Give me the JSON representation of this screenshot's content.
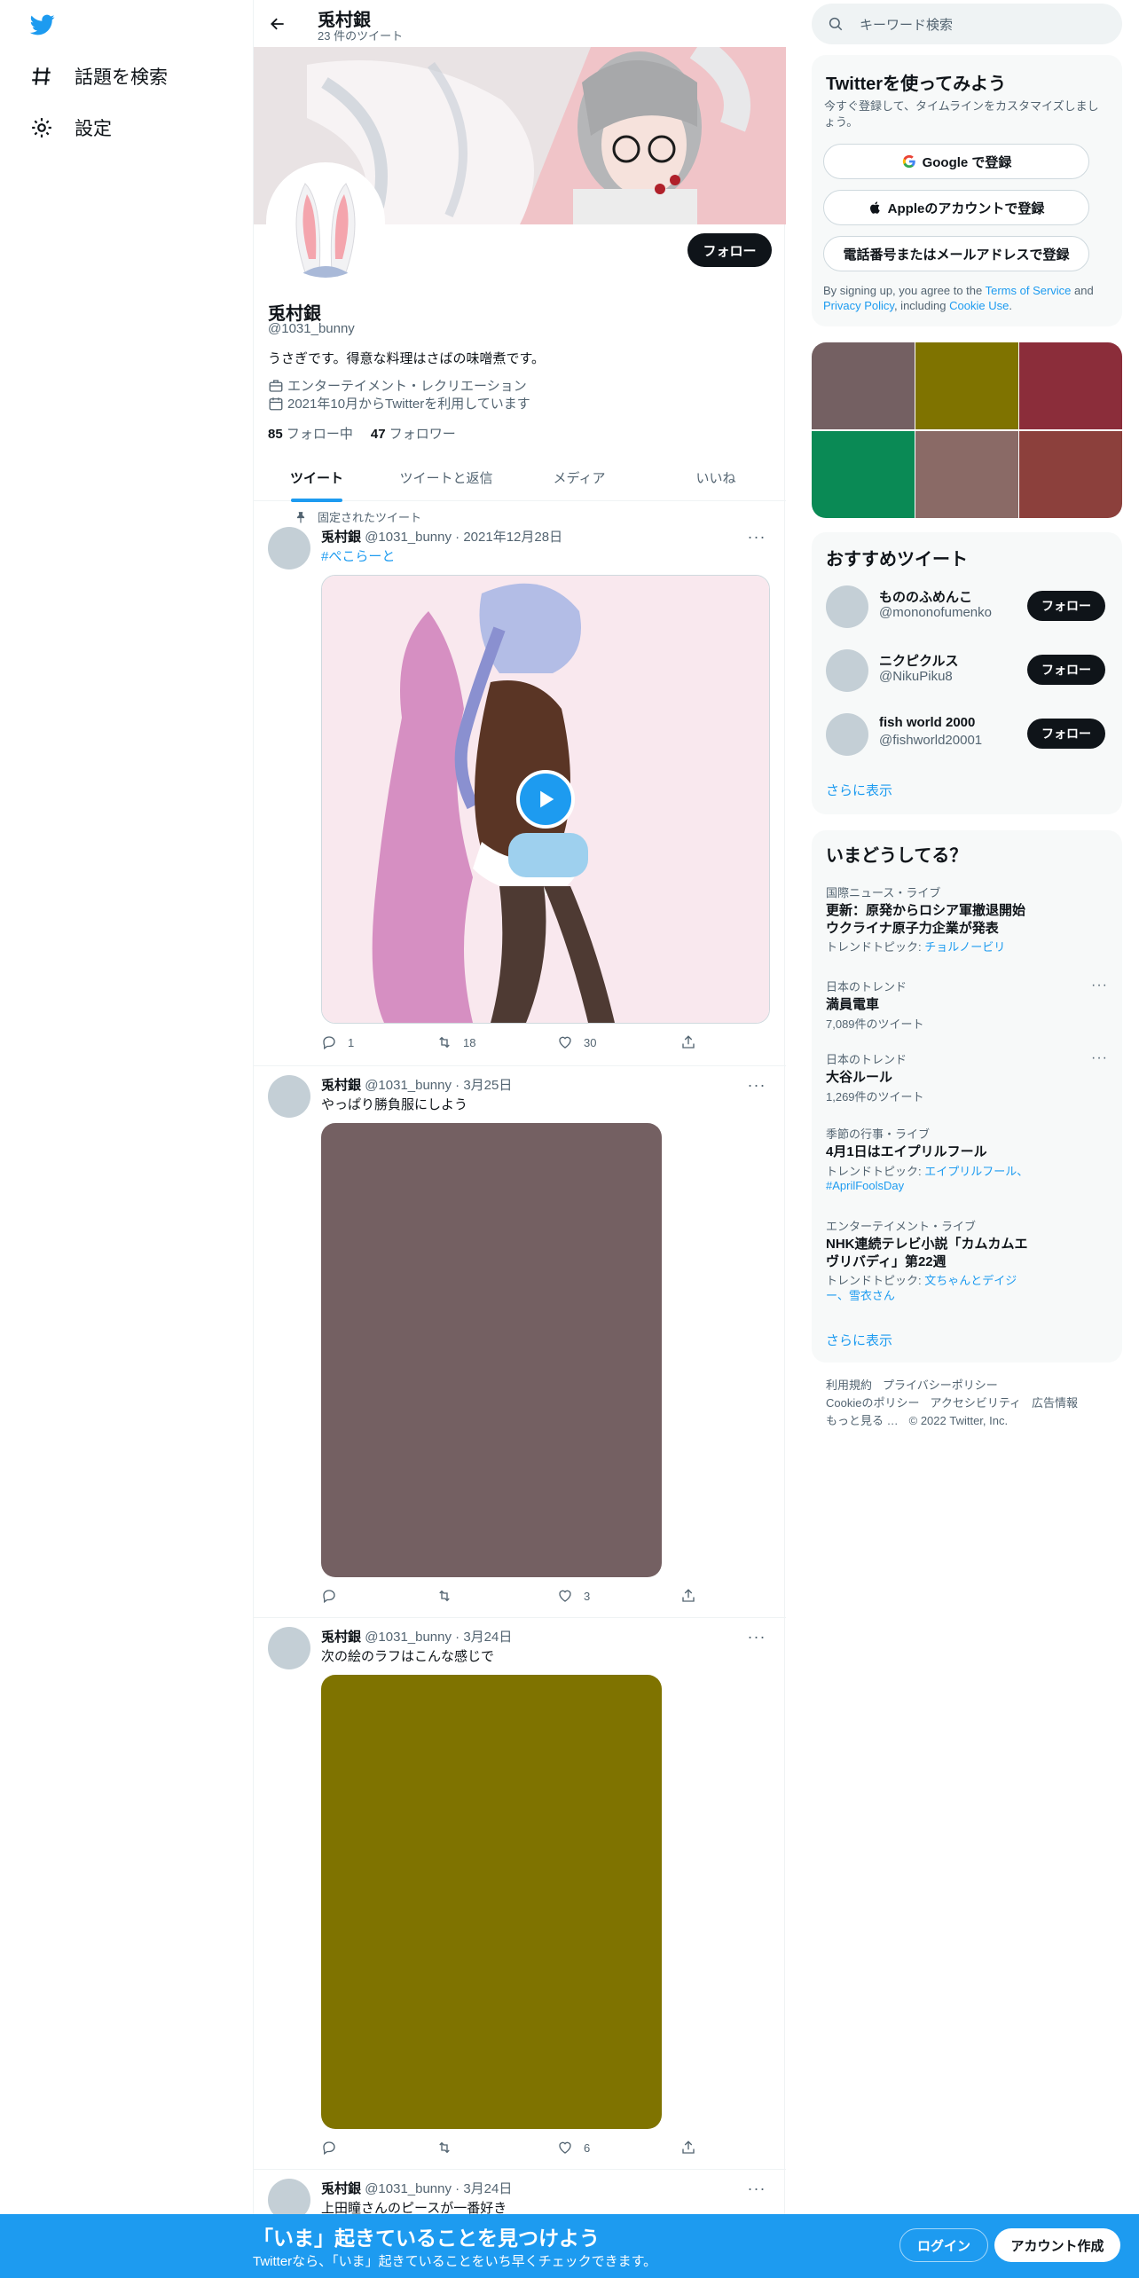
{
  "nav": {
    "explore_label": "話題を検索",
    "settings_label": "設定"
  },
  "profile": {
    "name": "兎村銀",
    "tweet_count": "23 件のツイート",
    "handle": "@1031_bunny",
    "bio": "うさぎです。得意な料理はさばの味噌煮です。",
    "category": "エンターテイメント・レクリエーション",
    "joined": "2021年10月からTwitterを利用しています",
    "following_count": "85",
    "following_label": "フォロー中",
    "followers_count": "47",
    "followers_label": "フォロワー",
    "follow_label": "フォロー"
  },
  "tabs": [
    "ツイート",
    "ツイートと返信",
    "メディア",
    "いいね"
  ],
  "pinned_label": "固定されたツイート",
  "tweets": [
    {
      "name": "兎村銀",
      "handle": "@1031_bunny",
      "date": "2021年12月28日",
      "text": "#ぺこらーと",
      "replies": "1",
      "retweets": "18",
      "likes": "30",
      "media_color": "#f9e6ec"
    },
    {
      "name": "兎村銀",
      "handle": "@1031_bunny",
      "date": "3月25日",
      "text": "やっぱり勝負服にしよう",
      "replies": "",
      "retweets": "",
      "likes": "3",
      "media_color": "#746062"
    },
    {
      "name": "兎村銀",
      "handle": "@1031_bunny",
      "date": "3月24日",
      "text": "次の絵のラフはこんな感じで",
      "replies": "",
      "retweets": "",
      "likes": "6",
      "media_color": "#7f7300"
    },
    {
      "name": "兎村銀",
      "handle": "@1031_bunny",
      "date": "3月24日",
      "text": "上田瞳さんのピースが一番好き"
    }
  ],
  "search": {
    "placeholder": "キーワード検索"
  },
  "signup": {
    "title": "Twitterを使ってみよう",
    "subtitle": "今すぐ登録して、タイムラインをカスタマイズしましょう。",
    "google_label": "Google で登録",
    "apple_label": "Appleのアカウントで登録",
    "phone_label": "電話番号またはメールアドレスで登録",
    "terms_prefix": "By signing up, you agree to the ",
    "terms_link": "Terms of Service",
    "terms_and": " and ",
    "privacy_link": "Privacy Policy",
    "terms_including": ", including ",
    "cookie_link": "Cookie Use",
    "terms_end": "."
  },
  "media_grid": [
    "#746062",
    "#7f7300",
    "#8b2d3a",
    "#0a8a55",
    "#8a6a66",
    "#8c403c"
  ],
  "recommended": {
    "title": "おすすめツイート",
    "items": [
      {
        "name": "もののふめんこ",
        "handle": "@mononofumenko",
        "button": "フォロー"
      },
      {
        "name": "ニクピクルス",
        "handle": "@NikuPiku8",
        "button": "フォロー"
      },
      {
        "name": "fish world 2000",
        "handle": "@fishworld20001",
        "button": "フォロー"
      }
    ],
    "more": "さらに表示"
  },
  "trends": {
    "title": "いまどうしてる？",
    "items": [
      {
        "category": "国際ニュース・ライブ",
        "name": "更新：原発からロシア軍撤退開始　ウクライナ原子力企業が発表",
        "sub_prefix": "トレンドトピック: ",
        "sub_link": "チョルノービリ"
      },
      {
        "category": "日本のトレンド",
        "name": "満員電車",
        "sub": "7,089件のツイート"
      },
      {
        "category": "日本のトレンド",
        "name": "大谷ルール",
        "sub": "1,269件のツイート"
      },
      {
        "category": "季節の行事・ライブ",
        "name": "4月1日はエイプリルフール",
        "sub_prefix": "トレンドトピック: ",
        "sub_link": "エイプリルフール、#AprilFoolsDay"
      },
      {
        "category": "エンターテイメント・ライブ",
        "name": "NHK連続テレビ小説「カムカムエヴリバディ」第22週",
        "sub_prefix": "トレンドトピック: ",
        "sub_link": "文ちゃんとデイジー、雪衣さん"
      }
    ],
    "more": "さらに表示"
  },
  "footer": {
    "links": [
      "利用規約",
      "プライバシーポリシー",
      "Cookieのポリシー",
      "アクセシビリティ",
      "広告情報",
      "もっと見る …",
      "© 2022 Twitter, Inc."
    ]
  },
  "bottom_bar": {
    "title": "「いま」起きていることを見つけよう",
    "subtitle": "Twitterなら、「いま」起きていることをいち早くチェックできます。",
    "login_label": "ログイン",
    "signup_label": "アカウント作成"
  },
  "colors": {
    "accent": "#1d9bf0",
    "dark_button": "#0f1419",
    "banner": "#f1c6c9"
  }
}
